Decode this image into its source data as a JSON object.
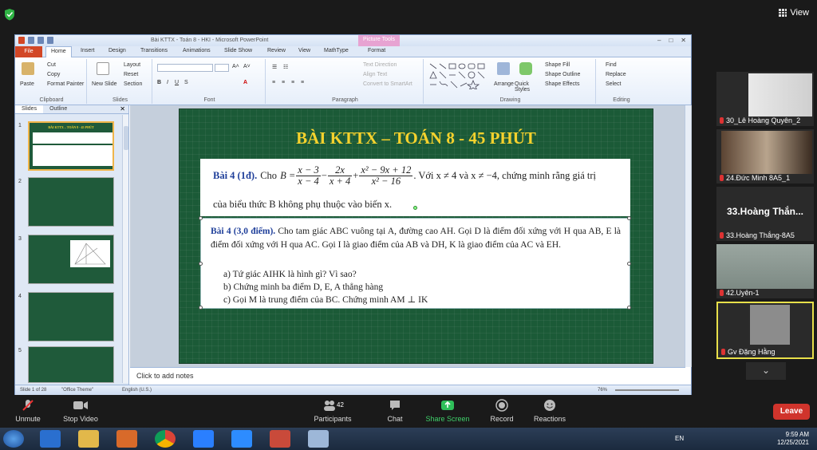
{
  "zoom": {
    "view_label": "View",
    "toolbar": [
      {
        "label": "Unmute",
        "icon": "mic-muted-icon"
      },
      {
        "label": "Stop Video",
        "icon": "video-icon"
      },
      {
        "label": "Participants",
        "icon": "participants-icon",
        "count": "42"
      },
      {
        "label": "Chat",
        "icon": "chat-icon"
      },
      {
        "label": "Share Screen",
        "icon": "share-screen-icon"
      },
      {
        "label": "Record",
        "icon": "record-icon"
      },
      {
        "label": "Reactions",
        "icon": "reactions-icon"
      }
    ],
    "leave_label": "Leave",
    "participants": [
      {
        "name": "30_Lê Hoàng Quyên_2"
      },
      {
        "name": "24.Đức Minh 8A5_1"
      },
      {
        "name": "33.Hoàng Thắng-8A5",
        "big_name": "33.Hoàng Thắn..."
      },
      {
        "name": "42.Uyên-1"
      },
      {
        "name": "Gv Đặng Hằng"
      }
    ]
  },
  "ppt": {
    "window_title": "Bài KTTX - Toán 8 - HKI - Microsoft PowerPoint",
    "picture_tools": "Picture Tools",
    "tabs": [
      "File",
      "Home",
      "Insert",
      "Design",
      "Transitions",
      "Animations",
      "Slide Show",
      "Review",
      "View",
      "MathType",
      "Format"
    ],
    "active_tab": "Home",
    "ribbon": {
      "clipboard": {
        "label": "Clipboard",
        "paste": "Paste",
        "cut": "Cut",
        "copy": "Copy",
        "format_painter": "Format Painter"
      },
      "slides": {
        "label": "Slides",
        "new_slide": "New Slide",
        "layout": "Layout",
        "reset": "Reset",
        "section": "Section"
      },
      "font": {
        "label": "Font"
      },
      "paragraph": {
        "label": "Paragraph",
        "text_direction": "Text Direction",
        "align_text": "Align Text",
        "convert": "Convert to SmartArt"
      },
      "drawing": {
        "label": "Drawing",
        "arrange": "Arrange",
        "quick_styles": "Quick Styles",
        "shape_fill": "Shape Fill",
        "shape_outline": "Shape Outline",
        "shape_effects": "Shape Effects"
      },
      "editing": {
        "label": "Editing",
        "find": "Find",
        "replace": "Replace",
        "select": "Select"
      }
    },
    "left_pane": {
      "tab_slides": "Slides",
      "tab_outline": "Outline",
      "slide_numbers": [
        "1",
        "2",
        "3",
        "4",
        "5"
      ]
    },
    "slide": {
      "title": "BÀI KTTX – TOÁN 8  - 45 PHÚT",
      "q1_label": "Bài 4 (1đ).",
      "q1_cho": "Cho",
      "q1_expr_var": "B =",
      "f1_num": "x − 3",
      "f1_den": "x − 4",
      "f2_num": "2x",
      "f2_den": "x + 4",
      "f3_num": "x² − 9x + 12",
      "f3_den": "x² − 16",
      "q1_cond": ". Với x ≠ 4 và x ≠ −4, chứng minh rằng giá trị",
      "q1_line2": "của biểu thức B không phụ thuộc vào biến x.",
      "q2_label": "Bài 4 (3,0 điểm).",
      "q2_text": "Cho tam giác ABC vuông tại A, đường cao AH. Gọi D là điểm đối xứng với H qua AB, E là điểm đối xứng với H qua AC. Gọi I là giao điểm của AB và DH, K là giao điểm của AC và EH.",
      "q2_items": [
        "a)   Tứ giác AIHK là hình gì? Vì sao?",
        "b)   Chứng minh ba điểm D, E, A thẳng hàng",
        "c)   Gọi M là trung điểm của BC. Chứng minh AM ⊥ IK"
      ]
    },
    "notes_placeholder": "Click to add notes",
    "status": {
      "slide_of": "Slide 1 of 28",
      "theme": "\"Office Theme\"",
      "lang": "English (U.S.)",
      "zoom": "76%"
    }
  },
  "taskbar": {
    "lang": "EN",
    "time": "9:59 AM",
    "date": "12/25/2021"
  }
}
